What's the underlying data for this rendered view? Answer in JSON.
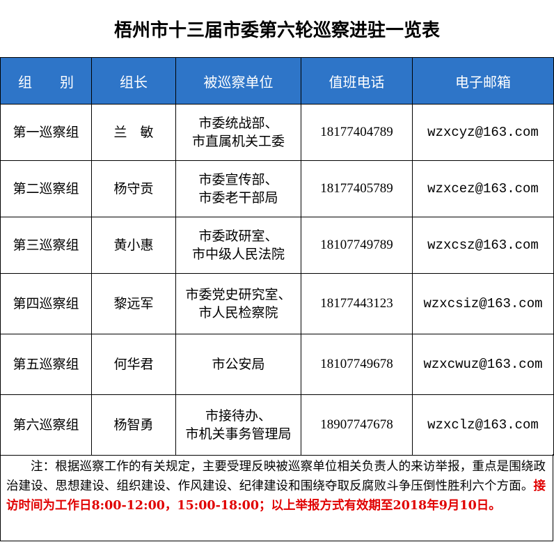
{
  "title": "梧州市十三届市委第六轮巡察进驻一览表",
  "header": {
    "group": "组　　别",
    "leader": "组长",
    "unit": "被巡察单位",
    "phone": "值班电话",
    "email": "电子邮箱"
  },
  "rows": [
    {
      "group": "第一巡察组",
      "leader": "兰　敏",
      "unit1": "市委统战部、",
      "unit2": "市直属机关工委",
      "phone": "18177404789",
      "email": "wzxcyz@163.com"
    },
    {
      "group": "第二巡察组",
      "leader": "杨守贡",
      "unit1": "市委宣传部、",
      "unit2": "市委老干部局",
      "phone": "18177405789",
      "email": "wzxcez@163.com"
    },
    {
      "group": "第三巡察组",
      "leader": "黄小惠",
      "unit1": "市委政研室、",
      "unit2": "市中级人民法院",
      "phone": "18107749789",
      "email": "wzxcsz@163.com"
    },
    {
      "group": "第四巡察组",
      "leader": "黎远军",
      "unit1": "市委党史研究室、",
      "unit2": "市人民检察院",
      "phone": "18177443123",
      "email": "wzxcsiz@163.com"
    },
    {
      "group": "第五巡察组",
      "leader": "何华君",
      "unit1": "市公安局",
      "unit2": "",
      "phone": "18107749678",
      "email": "wzxcwuz@163.com"
    },
    {
      "group": "第六巡察组",
      "leader": "杨智勇",
      "unit1": "市接待办、",
      "unit2": "市机关事务管理局",
      "phone": "18907747678",
      "email": "wzxclz@163.com"
    }
  ],
  "note": {
    "text": "注：根据巡察工作的有关规定，主要受理反映被巡察单位相关负责人的来访举报，重点是围绕政治建设、思想建设、组织建设、作风建设、纪律建设和围绕夺取反腐败斗争压倒性胜利六个方面。",
    "highlight": "接访时间为工作日8:00-12:00，15:00-18:00；以上举报方式有效期至2018年9月10日。"
  },
  "colors": {
    "header_bg": "#2e75c8",
    "email_text": "#8a1a9b",
    "highlight_text": "#e00000"
  }
}
